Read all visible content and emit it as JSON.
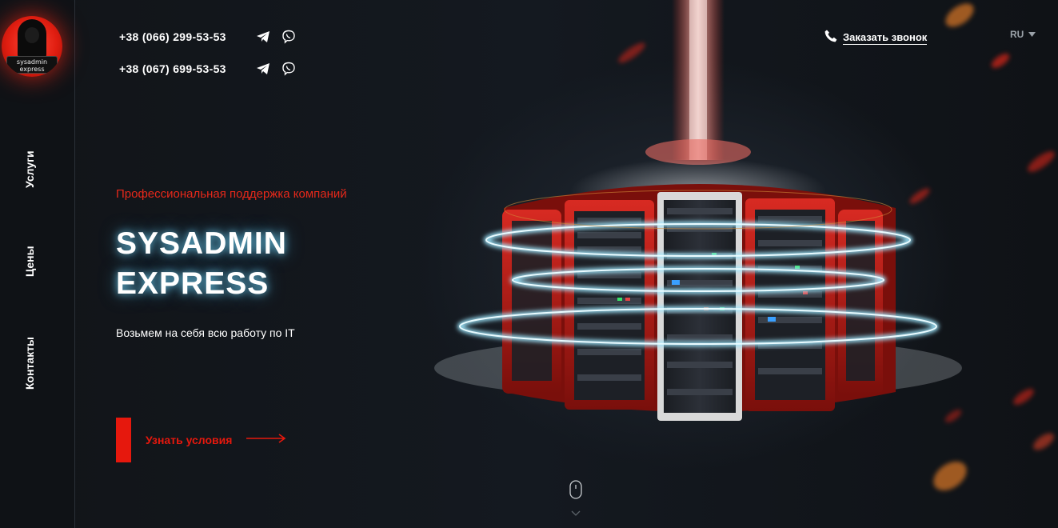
{
  "logo": {
    "line1": "sysadmin",
    "line2": "express"
  },
  "sidebar": {
    "items": [
      {
        "label": "Услуги"
      },
      {
        "label": "Цены"
      },
      {
        "label": "Контакты"
      }
    ]
  },
  "header": {
    "phones": [
      {
        "number": "+38 (066) 299-53-53"
      },
      {
        "number": "+38 (067) 699-53-53"
      }
    ],
    "callback_label": "Заказать звонок",
    "language": "RU"
  },
  "hero": {
    "tagline": "Профессиональная поддержка компаний",
    "title_line1": "SYSADMIN",
    "title_line2": "EXPRESS",
    "subtitle": "Возьмем на себя всю работу по IT",
    "cta_label": "Узнать условия"
  },
  "colors": {
    "accent": "#e6180d",
    "background": "#0e1116",
    "glow": "#7fdcff"
  },
  "icons": [
    "telegram-icon",
    "viber-icon",
    "phone-icon",
    "chevron-down-icon",
    "mouse-icon",
    "arrow-right-icon"
  ]
}
